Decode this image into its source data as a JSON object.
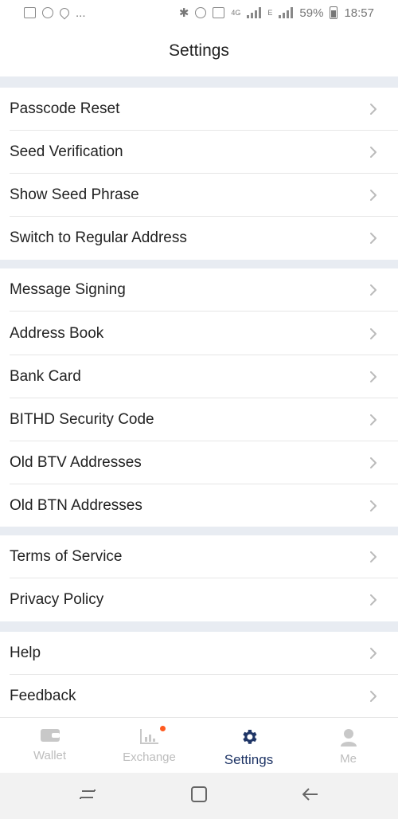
{
  "status_bar": {
    "dots": "...",
    "network": "4G",
    "signal_type": "E",
    "battery": "59%",
    "time": "18:57"
  },
  "header": {
    "title": "Settings"
  },
  "sections": [
    {
      "items": [
        {
          "label": "Passcode Reset"
        },
        {
          "label": "Seed Verification"
        },
        {
          "label": "Show Seed Phrase"
        },
        {
          "label": "Switch to Regular Address"
        }
      ]
    },
    {
      "items": [
        {
          "label": "Message Signing"
        },
        {
          "label": "Address Book"
        },
        {
          "label": "Bank Card"
        },
        {
          "label": "BITHD Security Code"
        },
        {
          "label": "Old BTV Addresses"
        },
        {
          "label": "Old BTN Addresses"
        }
      ]
    },
    {
      "items": [
        {
          "label": "Terms of Service"
        },
        {
          "label": "Privacy Policy"
        }
      ]
    },
    {
      "items": [
        {
          "label": "Help"
        },
        {
          "label": "Feedback"
        }
      ]
    }
  ],
  "tabbar": {
    "tabs": [
      {
        "label": "Wallet",
        "icon": "wallet-icon",
        "active": false
      },
      {
        "label": "Exchange",
        "icon": "chart-icon",
        "active": false,
        "badge": true
      },
      {
        "label": "Settings",
        "icon": "gear-icon",
        "active": true
      },
      {
        "label": "Me",
        "icon": "person-icon",
        "active": false
      }
    ]
  },
  "colors": {
    "accent": "#1f3566",
    "inactive": "#bdbdbd",
    "section_gap": "#e8ecf2",
    "badge": "#ff5a1f"
  }
}
